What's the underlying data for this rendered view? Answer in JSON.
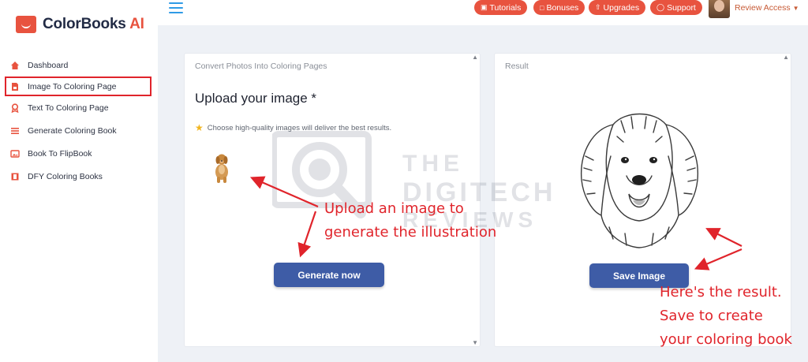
{
  "app": {
    "brand_main": "ColorBooks",
    "brand_accent": "AI"
  },
  "sidebar": {
    "items": [
      {
        "label": "Dashboard",
        "icon": "home-icon"
      },
      {
        "label": "Image To Coloring Page",
        "icon": "file-image-icon"
      },
      {
        "label": "Text To Coloring Page",
        "icon": "award-icon"
      },
      {
        "label": "Generate Coloring Book",
        "icon": "list-icon"
      },
      {
        "label": "Book To FlipBook",
        "icon": "image-icon"
      },
      {
        "label": "DFY Coloring Books",
        "icon": "film-icon"
      }
    ]
  },
  "topbar": {
    "tutorials": "Tutorials",
    "bonuses": "Bonuses",
    "upgrades": "Upgrades",
    "support": "Support",
    "user_menu": "Review Access"
  },
  "left_panel": {
    "title": "Convert Photos Into Coloring Pages",
    "heading": "Upload your image *",
    "tip": "Choose high-quality images will deliver the best results.",
    "button": "Generate now"
  },
  "right_panel": {
    "title": "Result",
    "button": "Save Image"
  },
  "watermark": {
    "line1": "THE",
    "line2": "DIGITECH",
    "line3": "REVIEWS"
  },
  "annotations": {
    "left_line1": "Upload an image to",
    "left_line2": "generate the illustration",
    "right_line1": "Here's the result.",
    "right_line2": "Save to create",
    "right_line3": "your coloring book"
  },
  "colors": {
    "accent": "#e8533f",
    "button": "#3e5ca6",
    "annotation": "#e0242b",
    "highlight_border": "#e0242b"
  }
}
